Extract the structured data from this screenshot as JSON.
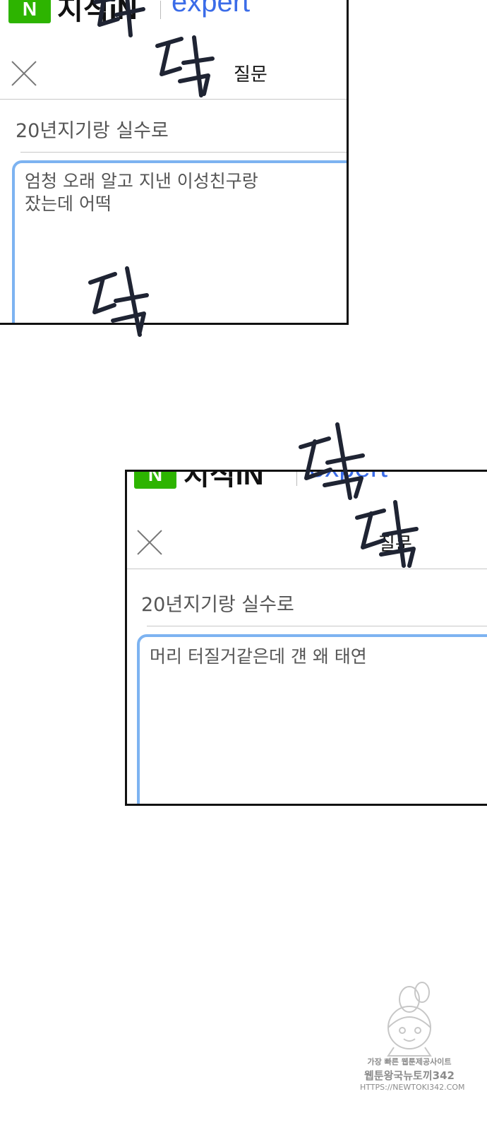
{
  "panel1": {
    "logo": "N",
    "brand": "지식iN",
    "expert": "expert",
    "header_title": "질문",
    "question_title": "20년지기랑 실수로",
    "body_text": "엄청 오래 알고 지낸 이성친구랑\n잤는데 어떡"
  },
  "panel2": {
    "logo": "N",
    "brand": "지식iN",
    "expert": "expert",
    "header_title": "질문",
    "question_title": "20년지기랑 실수로",
    "body_text": "머리 터질거같은데 걘 왜 태연"
  },
  "sfx": {
    "tak": "탁"
  },
  "watermark": {
    "line1": "가장 빠른 웹툰제공사이트",
    "line2": "웹툰왕국뉴토끼342",
    "line3": "HTTPS://NEWTOKI342.COM"
  },
  "colors": {
    "naver_green": "#2db400",
    "expert_blue": "#3b6ce8",
    "textbox_border": "#7db3f1",
    "panel_border": "#111111",
    "sfx_ink": "#1f2433"
  }
}
